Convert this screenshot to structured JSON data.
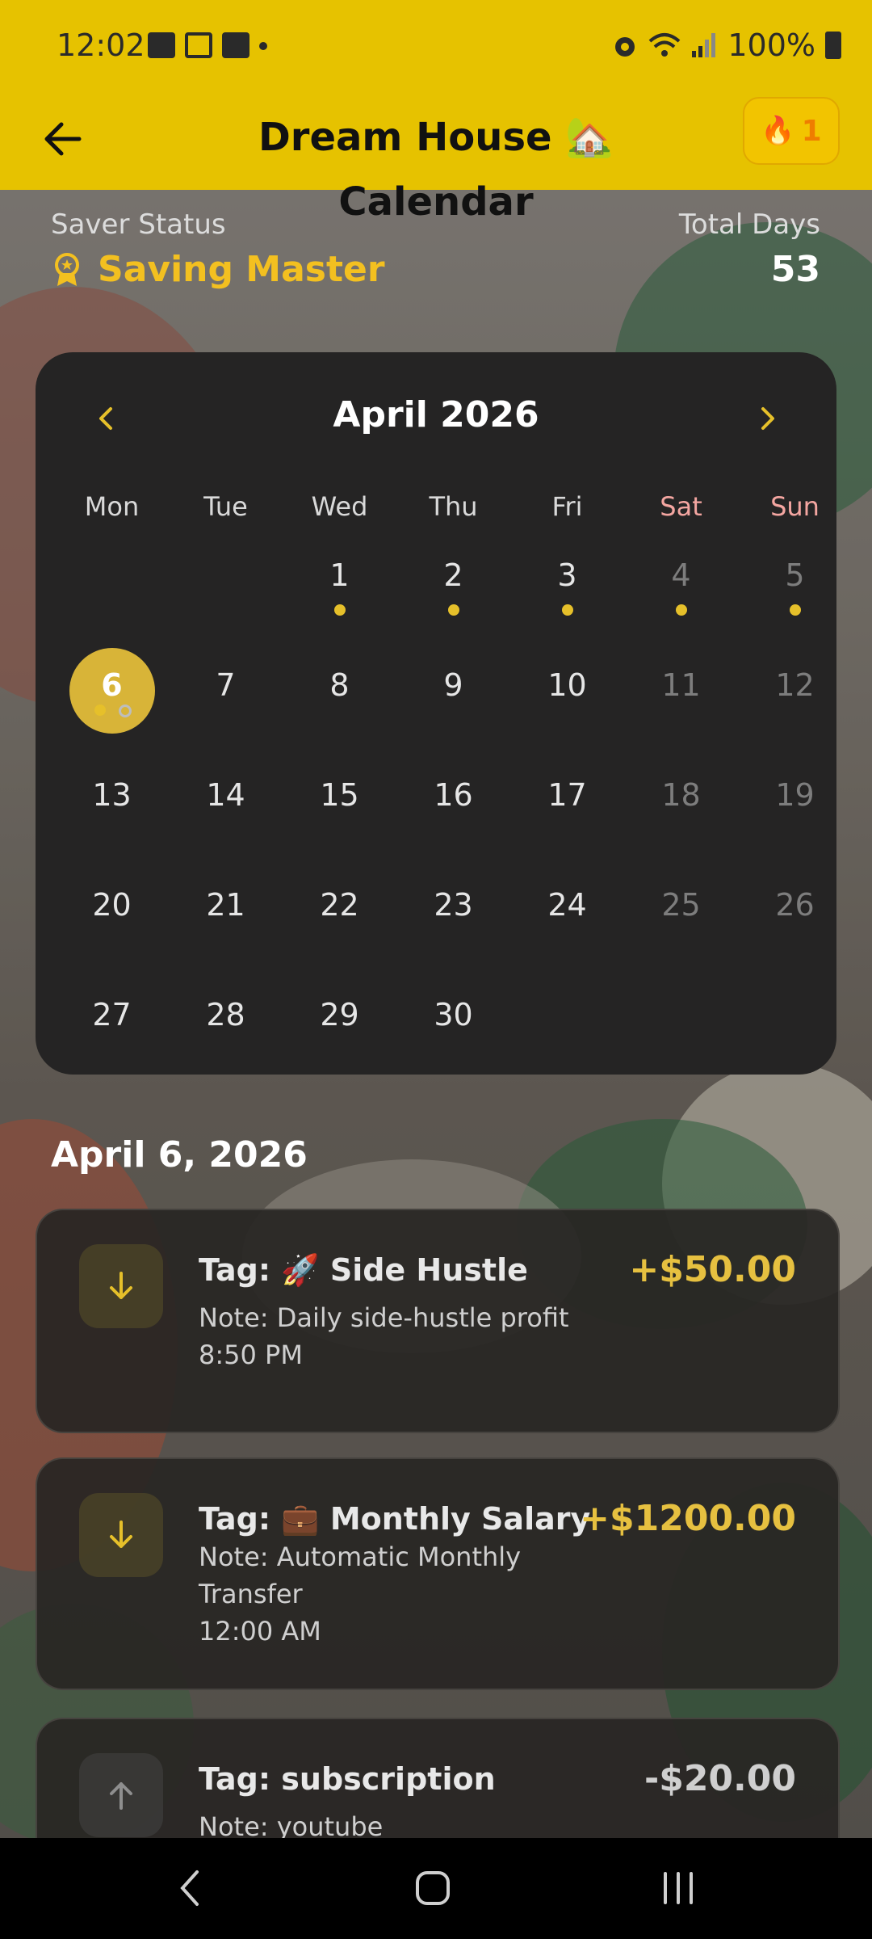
{
  "status_bar": {
    "time": "12:02",
    "battery": "100%"
  },
  "app_bar": {
    "title": "Dream House 🏡 Calendar",
    "streak_count": "1"
  },
  "saver": {
    "status_label": "Saver Status",
    "status_value": "Saving Master",
    "total_days_label": "Total Days",
    "total_days_value": "53"
  },
  "calendar": {
    "month_label": "April 2026",
    "weekdays": [
      "Mon",
      "Tue",
      "Wed",
      "Thu",
      "Fri",
      "Sat",
      "Sun"
    ],
    "first_weekday_index": 2,
    "days_in_month": 30,
    "today": 6,
    "days_with_entries": [
      1,
      2,
      3,
      4,
      5,
      6
    ],
    "days_with_secondary_marker": [
      6
    ]
  },
  "selected_date": "April 6, 2026",
  "transactions": [
    {
      "direction": "income",
      "tag": "Tag: 🚀 Side Hustle",
      "amount": "+$50.00",
      "note_lines": [
        "Note: Daily side-hustle profit",
        "8:50 PM"
      ]
    },
    {
      "direction": "income",
      "tag": "Tag: 💼 Monthly Salary",
      "amount": "+$1200.00",
      "note_lines": [
        "Note: Automatic Monthly",
        "Transfer",
        "12:00 AM"
      ]
    },
    {
      "direction": "expense",
      "tag": "Tag: subscription",
      "amount": "-$20.00",
      "note_lines": [
        "Note: youtube"
      ]
    }
  ],
  "colors": {
    "accent_yellow": "#e6c200",
    "income": "#e6c040",
    "weekend": "#f4a6a1",
    "card_bg": "#252424"
  },
  "icons": {
    "back": "arrow-left-icon",
    "streak": "flame-icon",
    "saver": "award-icon",
    "prev_month": "chevron-left-icon",
    "next_month": "chevron-right-icon",
    "income": "arrow-down-icon",
    "expense": "arrow-up-icon"
  }
}
